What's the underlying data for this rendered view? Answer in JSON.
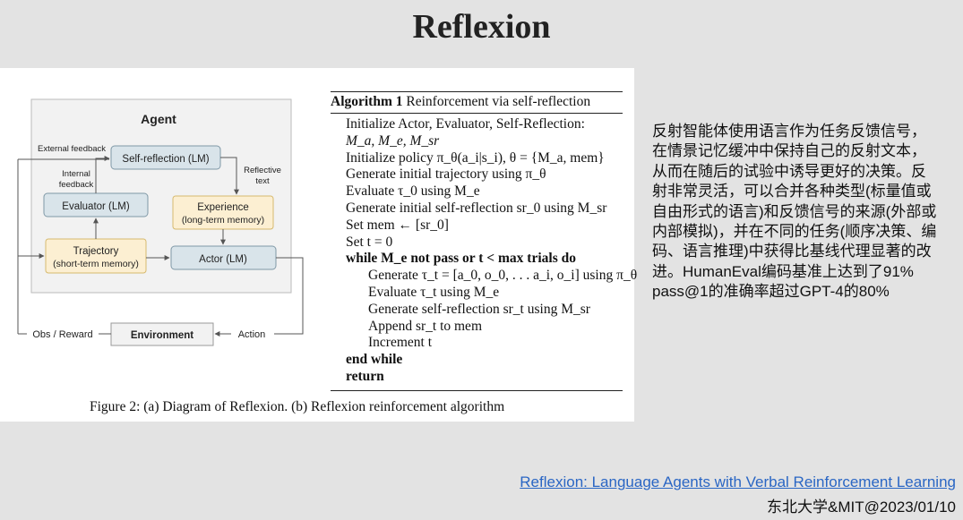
{
  "title": "Reflexion",
  "diagram": {
    "agent_label": "Agent",
    "self_reflection": "Self-reflection (LM)",
    "evaluator": "Evaluator (LM)",
    "experience_line1": "Experience",
    "experience_line2": "(long-term memory)",
    "trajectory_line1": "Trajectory",
    "trajectory_line2": "(short-term memory)",
    "actor": "Actor (LM)",
    "environment": "Environment",
    "external_feedback": "External feedback",
    "internal_feedback_line1": "Internal",
    "internal_feedback_line2": "feedback",
    "reflective_text_line1": "Reflective",
    "reflective_text_line2": "text",
    "obs_reward": "Obs / Reward",
    "action": "Action",
    "colors": {
      "blue_box": "#d9e4ea",
      "blue_border": "#7f98a6",
      "yellow_box": "#fcefd2",
      "yellow_border": "#d6b96e",
      "agent_bg": "#f2f2f2"
    }
  },
  "algorithm": {
    "header_bold": "Algorithm 1",
    "header_text": "Reinforcement via self-reflection",
    "lines": [
      "Initialize Actor, Evaluator, Self-Reflection:",
      "M_a, M_e, M_sr",
      "Initialize policy π_θ(a_i|s_i), θ = {M_a, mem}",
      "Generate initial trajectory using π_θ",
      "Evaluate τ_0 using M_e",
      "Generate initial self-reflection sr_0 using M_sr",
      "Set mem ← [sr_0]",
      "Set t = 0",
      "while M_e not pass or t < max trials do",
      "Generate τ_t = [a_0, o_0, . . . a_i, o_i] using π_θ",
      "Evaluate τ_t using M_e",
      "Generate self-reflection sr_t using M_sr",
      "Append sr_t to mem",
      "Increment t",
      "end while",
      "return"
    ]
  },
  "caption": "Figure 2: (a) Diagram of Reflexion. (b) Reflexion reinforcement algorithm",
  "description": "反射智能体使用语言作为任务反馈信号，在情景记忆缓冲中保持自己的反射文本，从而在随后的试验中诱导更好的决策。反射非常灵活，可以合并各种类型(标量值或自由形式的语言)和反馈信号的来源(外部或内部模拟)，并在不同的任务(顺序决策、编码、语言推理)中获得比基线代理显著的改进。HumanEval编码基准上达到了91% pass@1的准确率超过GPT-4的80%",
  "link_text": "Reflexion: Language Agents with Verbal Reinforcement Learning",
  "credit": "东北大学&MIT@2023/01/10"
}
